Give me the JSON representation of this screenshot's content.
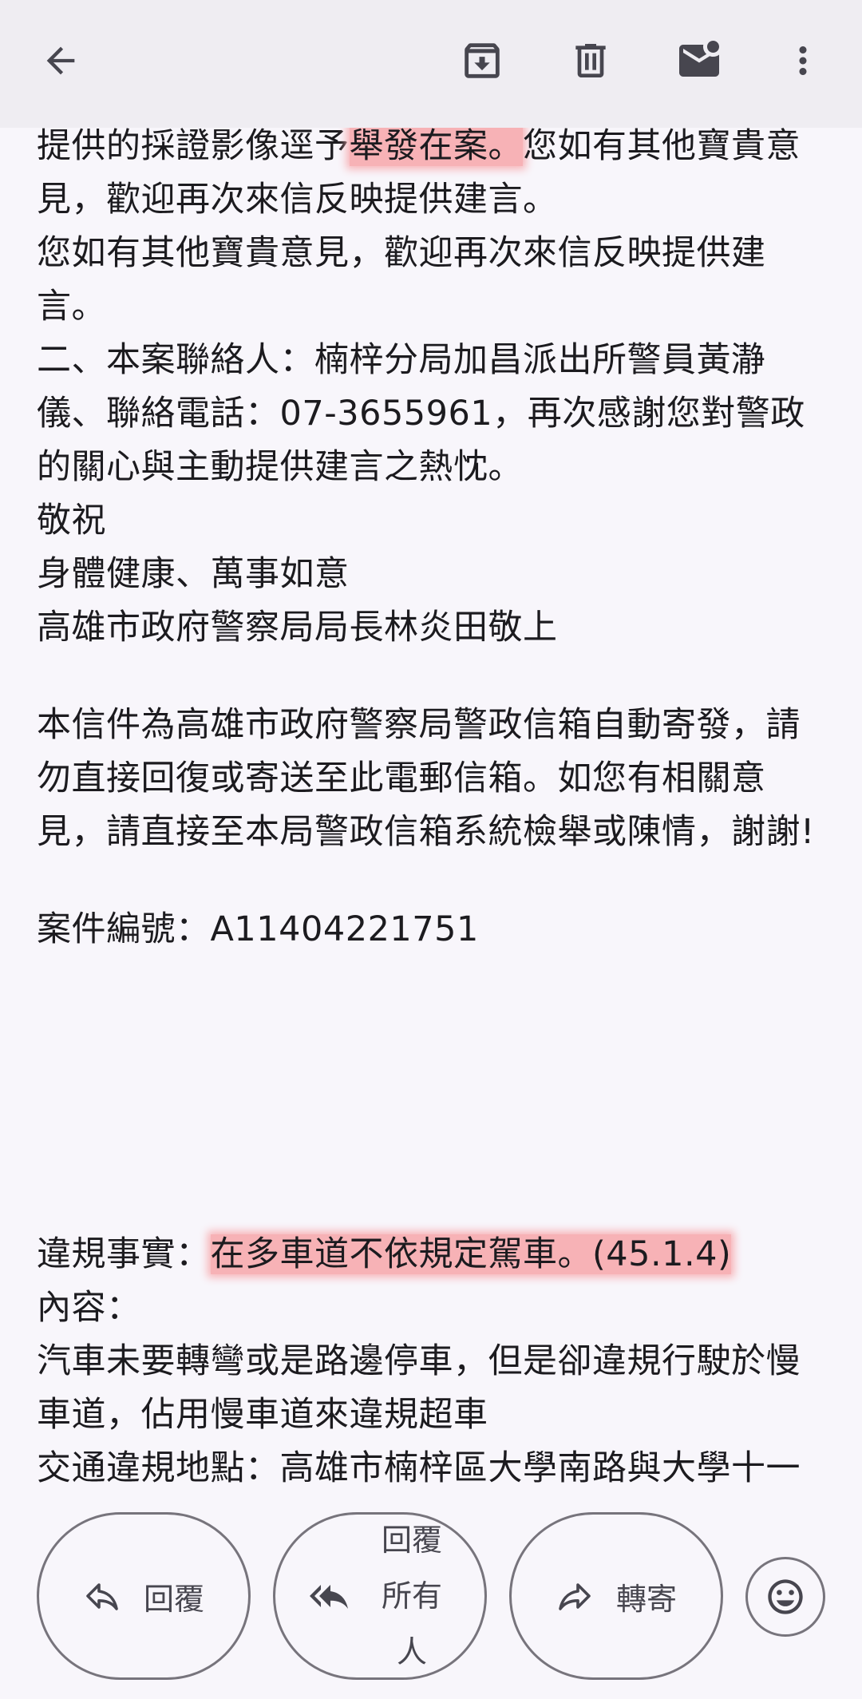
{
  "toolbar": {
    "back_icon": "arrow-left-icon",
    "archive_icon": "archive-icon",
    "delete_icon": "trash-icon",
    "mark_unread_icon": "mail-unread-icon",
    "more_icon": "more-vert-icon"
  },
  "body": {
    "lines": [
      {
        "pre": "提供的採證影像逕予",
        "hl": "舉發在案。",
        "post": "您如有其他寶貴意"
      },
      {
        "text": "見，歡迎再次來信反映提供建言。"
      },
      {
        "text": "您如有其他寶貴意見，歡迎再次來信反映提供建"
      },
      {
        "text": "言。"
      },
      {
        "text": "二、本案聯絡人：楠梓分局加昌派出所警員黃瀞"
      },
      {
        "text": "儀、聯絡電話：07-3655961，再次感謝您對警政"
      },
      {
        "text": "的關心與主動提供建言之熱忱。"
      },
      {
        "text": "敬祝"
      },
      {
        "text": "身體健康、萬事如意"
      },
      {
        "text": "高雄市政府警察局局長林炎田敬上"
      },
      {
        "text": "本信件為高雄市政府警察局警政信箱自動寄發，請"
      },
      {
        "text": "勿直接回復或寄送至此電郵信箱。如您有相關意"
      },
      {
        "text": "見，請直接至本局警政信箱系統檢舉或陳情，謝謝!"
      },
      {
        "text": "案件編號：A11404221751"
      },
      {
        "pre": "違規事實：",
        "hl": "在多車道不依規定駕車。(45.1.4)"
      },
      {
        "text": "內容："
      },
      {
        "text": "汽車未要轉彎或是路邊停車，但是卻違規行駛於慢"
      },
      {
        "text": "車道，佔用慢車道來違規超車"
      },
      {
        "text": "交通違規地點：高雄市楠梓區大學南路與大學十一"
      }
    ]
  },
  "actions": {
    "reply": "回覆",
    "reply_all": "回覆所有人",
    "forward": "轉寄",
    "emoji_icon": "emoji-icon"
  }
}
